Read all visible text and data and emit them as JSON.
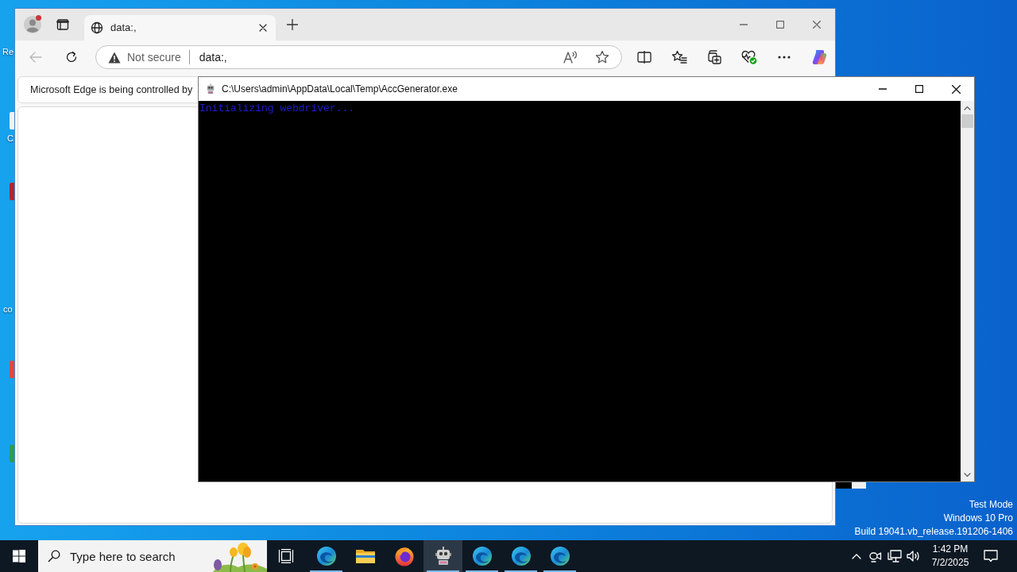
{
  "desktop": {
    "icons": [
      {
        "label": "Re"
      },
      {
        "color": "#f2f2f2",
        "label": "C"
      },
      {
        "color": "#b3262a"
      },
      {
        "label": "co"
      },
      {
        "color": "#e2483c"
      },
      {
        "color": "#2e9d4e"
      }
    ],
    "notice_lines": [
      "Test Mode",
      "Windows 10 Pro",
      "Build 19041.vb_release.191206-1406"
    ]
  },
  "browser": {
    "profile": {
      "notification": true
    },
    "tabs": [
      {
        "title": "data:,",
        "selected": true
      }
    ],
    "back": {
      "disabled": true
    },
    "address_bar": {
      "security": "Not secure",
      "url": "data:,"
    },
    "infobar": "Microsoft Edge is being controlled by"
  },
  "console": {
    "title": "C:\\Users\\admin\\AppData\\Local\\Temp\\AccGenerator.exe",
    "lines": [
      "Initializing webdriver..."
    ]
  },
  "taskbar": {
    "search": {
      "placeholder": "Type here to search"
    },
    "apps": [
      {
        "kind": "edge",
        "running": true,
        "selected": false
      },
      {
        "kind": "explorer",
        "running": false,
        "selected": false
      },
      {
        "kind": "firefox",
        "running": false,
        "selected": false
      },
      {
        "kind": "console",
        "running": true,
        "selected": true
      },
      {
        "kind": "edge",
        "running": true,
        "selected": false
      },
      {
        "kind": "edge",
        "running": true,
        "selected": false
      },
      {
        "kind": "edge",
        "running": true,
        "selected": false
      }
    ],
    "clock": {
      "time": "1:42 PM",
      "date": "7/2/2025"
    }
  }
}
